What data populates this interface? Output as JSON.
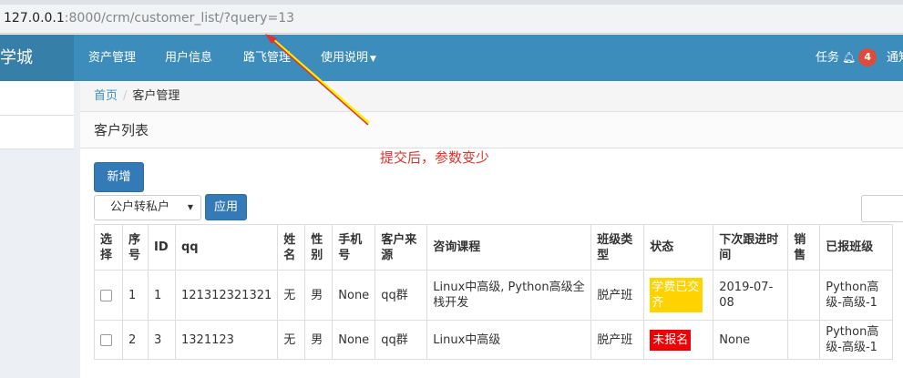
{
  "browser": {
    "url_host": "127.0.0.1",
    "url_rest": ":8000/crm/customer_list/?query=13"
  },
  "navbar": {
    "brand": "学城",
    "items": [
      "资产管理",
      "用户信息",
      "路飞管理",
      "使用说明"
    ],
    "tasks_label": "任务",
    "tasks_count": "4",
    "notice_label": "通知"
  },
  "breadcrumb": {
    "home": "首页",
    "separator": "/",
    "current": "客户管理"
  },
  "panel": {
    "title": "客户列表",
    "add_button": "新增",
    "action_select": "公户转私户",
    "apply_button": "应用"
  },
  "table": {
    "headers": [
      "选择",
      "序号",
      "ID",
      "qq",
      "姓名",
      "性别",
      "手机号",
      "客户来源",
      "咨询课程",
      "班级类型",
      "状态",
      "下次跟进时间",
      "销售",
      "已报班级"
    ],
    "rows": [
      {
        "index": "1",
        "id": "1",
        "qq": "121312321321",
        "name": "无",
        "gender": "男",
        "phone": "None",
        "source": "qq群",
        "course": "Linux中高级, Python高级全栈开发",
        "class_type": "脱产班",
        "status": "学费已交齐",
        "status_color": "#ffd200",
        "next_followup": "2019-07-08",
        "sales": "",
        "enrolled": "Python高级-高级-1"
      },
      {
        "index": "2",
        "id": "3",
        "qq": "1321123",
        "name": "无",
        "gender": "男",
        "phone": "None",
        "source": "qq群",
        "course": "Linux中高级",
        "class_type": "脱产班",
        "status": "未报名",
        "status_color": "#f00000",
        "next_followup": "None",
        "sales": "",
        "enrolled": "Python高级-高级-1"
      }
    ]
  },
  "annotation": {
    "text": "提交后，参数变少",
    "color": "#e0312a"
  }
}
